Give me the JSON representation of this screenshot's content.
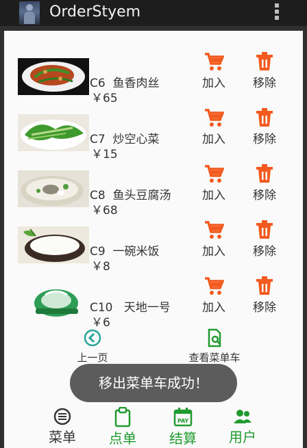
{
  "app": {
    "title": "OrderStyem"
  },
  "items": [
    {
      "code": "C6",
      "name": "鱼香肉丝",
      "price": "￥65",
      "add_label": "加入",
      "remove_label": "移除"
    },
    {
      "code": "C7",
      "name": "炒空心菜",
      "price": "￥15",
      "add_label": "加入",
      "remove_label": "移除"
    },
    {
      "code": "C8",
      "name": "鱼头豆腐汤",
      "price": "￥68",
      "add_label": "加入",
      "remove_label": "移除"
    },
    {
      "code": "C9",
      "name": "一碗米饭",
      "price": "￥8",
      "add_label": "加入",
      "remove_label": "移除"
    },
    {
      "code": "C10",
      "name": "天地一号",
      "price": "￥6",
      "add_label": "加入",
      "remove_label": "移除"
    }
  ],
  "pager": {
    "prev_label": "上一页",
    "cart_label": "查看菜单车"
  },
  "toast": {
    "text": "移出菜单车成功！"
  },
  "tabs": [
    {
      "label": "菜单",
      "icon": "menu-list-icon",
      "active": false
    },
    {
      "label": "点单",
      "icon": "clipboard-icon",
      "active": true
    },
    {
      "label": "结算",
      "icon": "pay-calendar-icon",
      "active": true
    },
    {
      "label": "用户",
      "icon": "users-icon",
      "active": true
    }
  ],
  "colors": {
    "accent_red": "#f25a1f",
    "teal": "#27a59a",
    "green": "#1f9a2e",
    "dark": "#333333"
  }
}
